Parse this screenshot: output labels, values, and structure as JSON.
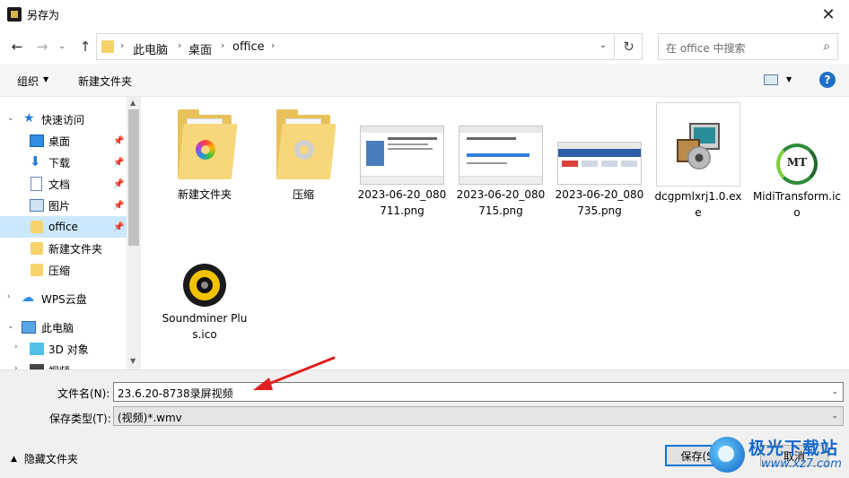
{
  "window": {
    "title": "另存为",
    "close_glyph": "✕"
  },
  "address_bar": {
    "breadcrumbs": [
      "此电脑",
      "桌面",
      "office"
    ],
    "separator": "›",
    "dropdown_glyph": "⌄"
  },
  "search": {
    "placeholder": "在 office 中搜索"
  },
  "toolbar": {
    "organize": "组织",
    "new_folder": "新建文件夹",
    "help": "?"
  },
  "nav_pane": {
    "items": [
      {
        "label": "快速访问",
        "icon": "star-icon",
        "expand": "⌄"
      },
      {
        "label": "桌面",
        "icon": "desktop-icon",
        "pinned": true
      },
      {
        "label": "下载",
        "icon": "download-icon",
        "pinned": true
      },
      {
        "label": "文档",
        "icon": "document-icon",
        "pinned": true
      },
      {
        "label": "图片",
        "icon": "picture-icon",
        "pinned": true
      },
      {
        "label": "office",
        "icon": "folder-icon",
        "pinned": true,
        "selected": true
      },
      {
        "label": "新建文件夹",
        "icon": "folder-icon"
      },
      {
        "label": "压缩",
        "icon": "folder-icon"
      },
      {
        "label": "WPS云盘",
        "icon": "cloud-icon",
        "expand": "›"
      },
      {
        "label": "此电脑",
        "icon": "computer-icon",
        "expand": "⌄"
      },
      {
        "label": "3D 对象",
        "icon": "3d-objects-icon",
        "expand": "›"
      },
      {
        "label": "视频",
        "icon": "video-icon",
        "expand": "›"
      }
    ]
  },
  "files": [
    {
      "name": "新建文件夹",
      "icon": "folder-color-icon"
    },
    {
      "name": "压缩",
      "icon": "folder-gear-icon"
    },
    {
      "name": "2023-06-20_080711.png",
      "icon": "image-thumbnail"
    },
    {
      "name": "2023-06-20_080715.png",
      "icon": "image-thumbnail"
    },
    {
      "name": "2023-06-20_080735.png",
      "icon": "image-thumbnail"
    },
    {
      "name": "dcgpmlxrj1.0.exe",
      "icon": "installer-icon"
    },
    {
      "name": "MidiTransform.ico",
      "icon": "midi-transform-icon"
    },
    {
      "name": "Soundminer Plus.ico",
      "icon": "soundminer-icon"
    }
  ],
  "form": {
    "filename_label": "文件名(N):",
    "filename_value": "23.6.20-8738录屏视频",
    "filetype_label": "保存类型(T):",
    "filetype_value": "(视频)*.wmv",
    "hide_folders": "隐藏文件夹",
    "save": "保存(S)",
    "cancel": "取消"
  },
  "watermark": {
    "title": "极光下载站",
    "url": "www.xz7.com"
  },
  "colors": {
    "accent": "#0078d7",
    "selection": "#cce8ff",
    "arrow": "#e02020"
  }
}
